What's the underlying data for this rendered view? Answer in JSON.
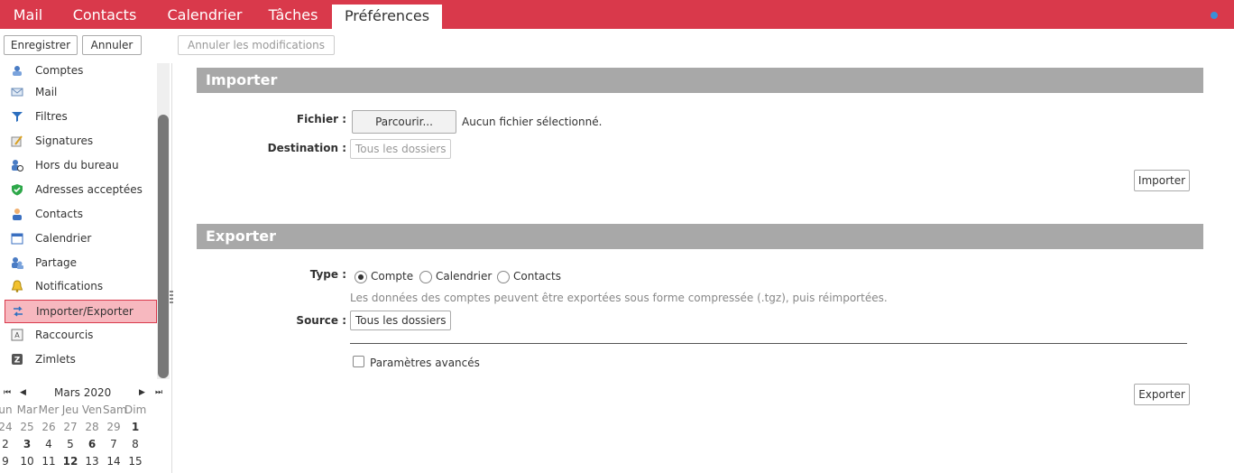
{
  "nav": {
    "tabs": [
      {
        "label": "Mail"
      },
      {
        "label": "Contacts"
      },
      {
        "label": "Calendrier"
      },
      {
        "label": "Tâches"
      },
      {
        "label": "Préférences"
      }
    ]
  },
  "toolbar": {
    "save_label": "Enregistrer",
    "cancel_label": "Annuler",
    "revert_label": "Annuler les modifications"
  },
  "sidebar": {
    "items": [
      {
        "label": "Comptes",
        "icon": "accounts-icon"
      },
      {
        "label": "Mail",
        "icon": "mail-icon"
      },
      {
        "label": "Filtres",
        "icon": "filter-icon"
      },
      {
        "label": "Signatures",
        "icon": "signature-icon"
      },
      {
        "label": "Hors du bureau",
        "icon": "out-of-office-icon"
      },
      {
        "label": "Adresses acceptées",
        "icon": "trusted-addresses-icon"
      },
      {
        "label": "Contacts",
        "icon": "contacts-icon"
      },
      {
        "label": "Calendrier",
        "icon": "calendar-icon"
      },
      {
        "label": "Partage",
        "icon": "sharing-icon"
      },
      {
        "label": "Notifications",
        "icon": "bell-icon"
      },
      {
        "label": "Importer/Exporter",
        "icon": "import-export-icon",
        "selected": true
      },
      {
        "label": "Raccourcis",
        "icon": "shortcuts-icon"
      },
      {
        "label": "Zimlets",
        "icon": "zimlets-icon"
      }
    ]
  },
  "mini_calendar": {
    "month_label": "Mars 2020",
    "nav_first": "⏮",
    "nav_prev": "◀",
    "nav_next": "▶",
    "nav_last": "⏭",
    "weekdays": [
      "un",
      "Mar",
      "Mer",
      "Jeu",
      "Ven",
      "Sam",
      "Dim"
    ],
    "weeks": [
      [
        {
          "d": "24",
          "dim": true
        },
        {
          "d": "25",
          "dim": true
        },
        {
          "d": "26",
          "dim": true
        },
        {
          "d": "27",
          "dim": true
        },
        {
          "d": "28",
          "dim": true
        },
        {
          "d": "29",
          "dim": true
        },
        {
          "d": "1",
          "bold": true
        }
      ],
      [
        {
          "d": "2"
        },
        {
          "d": "3",
          "bold": true
        },
        {
          "d": "4"
        },
        {
          "d": "5"
        },
        {
          "d": "6",
          "bold": true
        },
        {
          "d": "7"
        },
        {
          "d": "8"
        }
      ],
      [
        {
          "d": "9"
        },
        {
          "d": "10"
        },
        {
          "d": "11"
        },
        {
          "d": "12",
          "bold": true
        },
        {
          "d": "13"
        },
        {
          "d": "14"
        },
        {
          "d": "15"
        }
      ]
    ]
  },
  "import": {
    "header": "Importer",
    "file_label": "Fichier :",
    "browse_label": "Parcourir...",
    "no_file_text": "Aucun fichier sélectionné.",
    "destination_label": "Destination :",
    "destination_value": "Tous les dossiers",
    "submit_label": "Importer"
  },
  "export": {
    "header": "Exporter",
    "type_label": "Type :",
    "type_options": [
      {
        "label": "Compte",
        "selected": true
      },
      {
        "label": "Calendrier",
        "selected": false
      },
      {
        "label": "Contacts",
        "selected": false
      }
    ],
    "hint": "Les données des comptes peuvent être exportées sous forme compressée (.tgz), puis réimportées.",
    "source_label": "Source :",
    "source_value": "Tous les dossiers",
    "advanced_label": "Paramètres avancés",
    "advanced_checked": false,
    "submit_label": "Exporter"
  },
  "colors": {
    "brand": "#d9394b",
    "section_header": "#a8a8a8",
    "selected_bg": "#f7b8bf"
  }
}
